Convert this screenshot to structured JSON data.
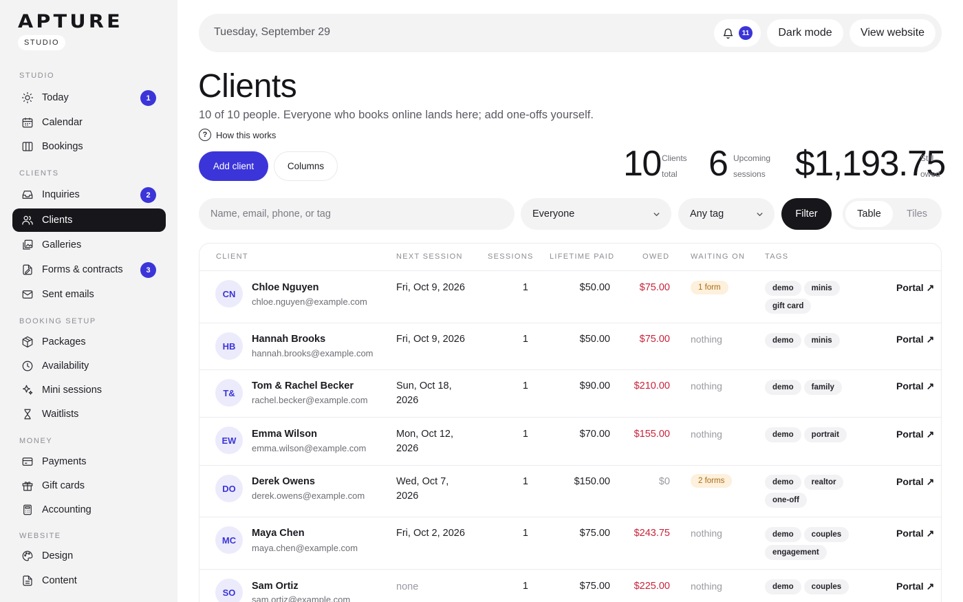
{
  "brand": {
    "logo": "APTURE",
    "sub": "STUDIO"
  },
  "sidebar": {
    "sections": [
      {
        "label": "STUDIO"
      },
      {
        "label": "CLIENTS"
      },
      {
        "label": "BOOKING SETUP"
      },
      {
        "label": "MONEY"
      },
      {
        "label": "WEBSITE"
      }
    ],
    "items": [
      {
        "label": "Today",
        "icon": "sun-icon",
        "badge": "1"
      },
      {
        "label": "Calendar",
        "icon": "calendar-icon"
      },
      {
        "label": "Bookings",
        "icon": "columns-icon"
      },
      {
        "label": "Inquiries",
        "icon": "inbox-icon",
        "badge": "2"
      },
      {
        "label": "Clients",
        "icon": "users-icon",
        "active": true
      },
      {
        "label": "Galleries",
        "icon": "gallery-icon"
      },
      {
        "label": "Forms & contracts",
        "icon": "form-icon",
        "badge": "3"
      },
      {
        "label": "Sent emails",
        "icon": "mail-icon"
      },
      {
        "label": "Packages",
        "icon": "package-icon"
      },
      {
        "label": "Availability",
        "icon": "clock-icon"
      },
      {
        "label": "Mini sessions",
        "icon": "sparkles-icon"
      },
      {
        "label": "Waitlists",
        "icon": "hourglass-icon"
      },
      {
        "label": "Payments",
        "icon": "credit-card-icon"
      },
      {
        "label": "Gift cards",
        "icon": "gift-icon"
      },
      {
        "label": "Accounting",
        "icon": "calculator-icon"
      },
      {
        "label": "Design",
        "icon": "palette-icon"
      },
      {
        "label": "Content",
        "icon": "document-icon"
      }
    ]
  },
  "topbar": {
    "date": "Tuesday, September 29",
    "notifications": "11",
    "dark_mode": "Dark mode",
    "view_website": "View website"
  },
  "header": {
    "title": "Clients",
    "subtitle": "10 of 10 people. Everyone who books online lands here; add one-offs yourself.",
    "how_it_works": "How this works",
    "add_client": "Add client",
    "columns": "Columns"
  },
  "stats": [
    {
      "value": "10",
      "label_1": "Clients",
      "label_2": "total"
    },
    {
      "value": "6",
      "label_1": "Upcoming",
      "label_2": "sessions"
    },
    {
      "value": "$1,193.75",
      "label_1": "Still",
      "label_2": "owed"
    }
  ],
  "filters": {
    "search_placeholder": "Name, email, phone, or tag",
    "audience": "Everyone",
    "tag": "Any tag",
    "filter_button": "Filter",
    "view_table": "Table",
    "view_tiles": "Tiles"
  },
  "table": {
    "columns": [
      "CLIENT",
      "NEXT SESSION",
      "SESSIONS",
      "LIFETIME PAID",
      "OWED",
      "WAITING ON",
      "TAGS"
    ],
    "portal_label": "Portal ↗",
    "rows": [
      {
        "initials": "CN",
        "name": "Chloe Nguyen",
        "email": "chloe.nguyen@example.com",
        "session": "Fri, Oct 9, 2026",
        "sessions": "1",
        "paid": "$50.00",
        "owed": "$75.00",
        "waiting": "1 form",
        "tags": [
          "demo",
          "minis",
          "gift card"
        ]
      },
      {
        "initials": "HB",
        "name": "Hannah Brooks",
        "email": "hannah.brooks@example.com",
        "session": "Fri, Oct 9, 2026",
        "sessions": "1",
        "paid": "$50.00",
        "owed": "$75.00",
        "waiting": "nothing",
        "tags": [
          "demo",
          "minis"
        ]
      },
      {
        "initials": "T&",
        "name": "Tom & Rachel Becker",
        "email": "rachel.becker@example.com",
        "session": "Sun, Oct 18, 2026",
        "sessions": "1",
        "paid": "$90.00",
        "owed": "$210.00",
        "waiting": "nothing",
        "tags": [
          "demo",
          "family"
        ]
      },
      {
        "initials": "EW",
        "name": "Emma Wilson",
        "email": "emma.wilson@example.com",
        "session": "Mon, Oct 12, 2026",
        "sessions": "1",
        "paid": "$70.00",
        "owed": "$155.00",
        "waiting": "nothing",
        "tags": [
          "demo",
          "portrait"
        ]
      },
      {
        "initials": "DO",
        "name": "Derek Owens",
        "email": "derek.owens@example.com",
        "session": "Wed, Oct 7, 2026",
        "sessions": "1",
        "paid": "$150.00",
        "owed": "$0",
        "waiting": "2 forms",
        "tags": [
          "demo",
          "realtor",
          "one-off"
        ]
      },
      {
        "initials": "MC",
        "name": "Maya Chen",
        "email": "maya.chen@example.com",
        "session": "Fri, Oct 2, 2026",
        "sessions": "1",
        "paid": "$75.00",
        "owed": "$243.75",
        "waiting": "nothing",
        "tags": [
          "demo",
          "couples",
          "engagement"
        ]
      },
      {
        "initials": "SO",
        "name": "Sam Ortiz",
        "email": "sam.ortiz@example.com",
        "session": "none",
        "sessions": "1",
        "paid": "$75.00",
        "owed": "$225.00",
        "waiting": "nothing",
        "tags": [
          "demo",
          "couples"
        ]
      }
    ]
  }
}
